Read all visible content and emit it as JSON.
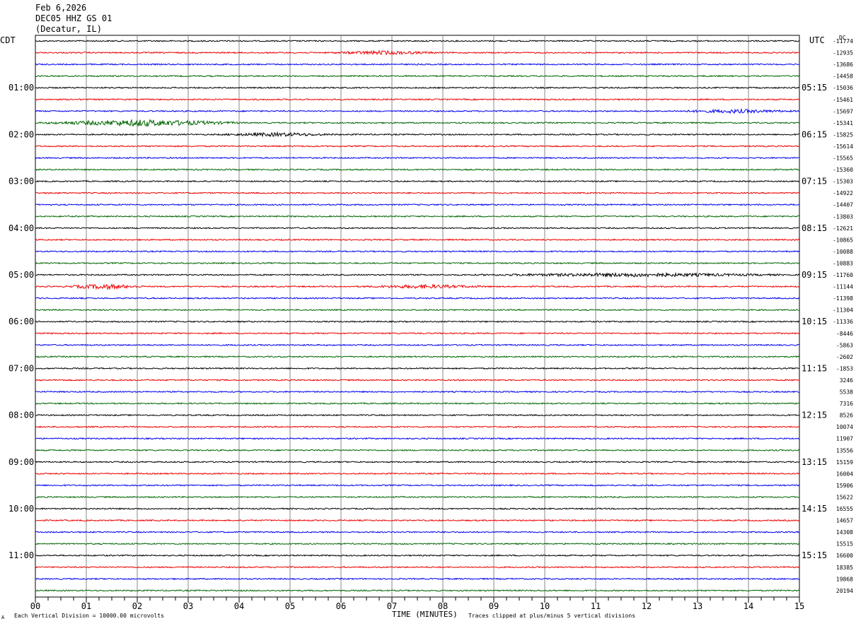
{
  "header": {
    "date": "Feb 6,2026",
    "station": "DEC05 HHZ GS 01",
    "location": "(Decatur, IL)"
  },
  "left_timezone": "CDT",
  "right_timezone": "UTC",
  "right_column_label": "DC",
  "footer": {
    "scale_note": "Each Vertical Division = 10000.00 microvolts",
    "clip_note": "Traces clipped at plus/minus 5 vertical divisions",
    "corner_mark": "A"
  },
  "colors": {
    "trace_cycle": [
      "#000000",
      "#ee0000",
      "#0000ee",
      "#006600"
    ],
    "grid": "#888888"
  },
  "chart_data": {
    "type": "line",
    "xlabel": "TIME (MINUTES)",
    "xlim": [
      0,
      15
    ],
    "x_ticks": [
      "00",
      "01",
      "02",
      "03",
      "04",
      "05",
      "06",
      "07",
      "08",
      "09",
      "10",
      "11",
      "12",
      "13",
      "14",
      "15"
    ],
    "left_hour_labels": [
      "01:00",
      "02:00",
      "03:00",
      "04:00",
      "05:00",
      "06:00",
      "07:00",
      "08:00",
      "09:00",
      "10:00",
      "11:00"
    ],
    "right_hour_labels": [
      "05:15",
      "06:15",
      "07:15",
      "08:15",
      "09:15",
      "10:15",
      "11:15",
      "12:15",
      "13:15",
      "14:15",
      "15:15"
    ],
    "hour_label_first_trace": 4,
    "traces_per_hour": 4,
    "trace_count": 48,
    "dc_offsets": [
      "-11774",
      "-12935",
      "-13686",
      "-14458",
      "-15036",
      "-15461",
      "-15697",
      "-15341",
      "-15825",
      "-15614",
      "-15565",
      "-15360",
      "-15303",
      "-14922",
      "-14407",
      "-13803",
      "-12621",
      "-10865",
      "-10088",
      "-10883",
      "-11760",
      "-11144",
      "-11398",
      "-11304",
      "-11336",
      "-8446",
      "-5863",
      "-2602",
      "-1853",
      "3246",
      "5538",
      "7316",
      "8526",
      "10074",
      "11907",
      "13556",
      "15159",
      "16004",
      "15906",
      "15622",
      "16555",
      "14657",
      "14308",
      "15515",
      "16600",
      "18385",
      "19868",
      "20194"
    ],
    "event_bursts": [
      {
        "trace": 1,
        "start_min": 5.7,
        "end_min": 8.0,
        "level": 2
      },
      {
        "trace": 7,
        "start_min": 0.0,
        "end_min": 4.2,
        "level": 4
      },
      {
        "trace": 8,
        "start_min": 3.5,
        "end_min": 6.0,
        "level": 2
      },
      {
        "trace": 6,
        "start_min": 12.5,
        "end_min": 15.0,
        "level": 2
      },
      {
        "trace": 20,
        "start_min": 8.5,
        "end_min": 15.0,
        "level": 2
      },
      {
        "trace": 21,
        "start_min": 0.5,
        "end_min": 2.2,
        "level": 3
      },
      {
        "trace": 21,
        "start_min": 6.3,
        "end_min": 9.0,
        "level": 2
      }
    ]
  }
}
